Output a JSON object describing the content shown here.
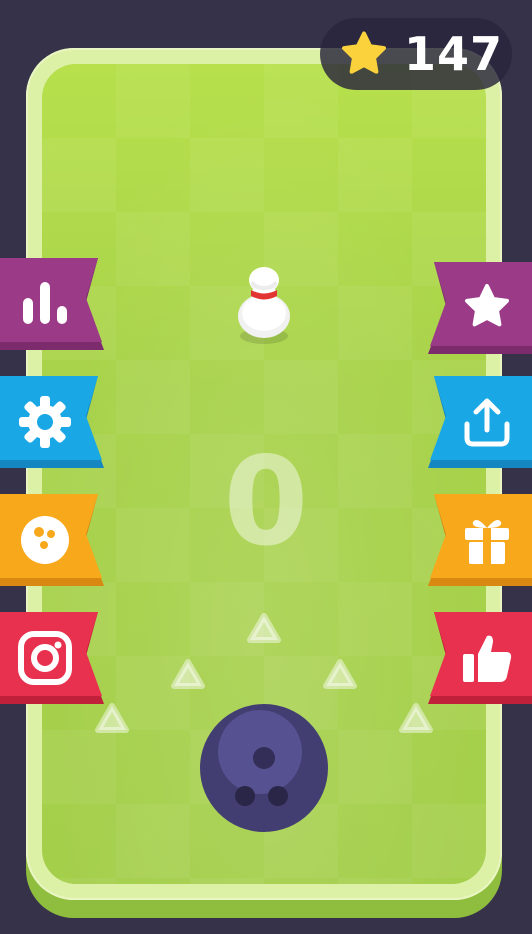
{
  "hud": {
    "score": "147",
    "score_icon": "star-icon",
    "throw_count": "0"
  },
  "left_menu": [
    {
      "id": "leaderboard",
      "icon": "bar-chart-icon",
      "color": "#9b3a87"
    },
    {
      "id": "settings",
      "icon": "gear-icon",
      "color": "#1aa7e6"
    },
    {
      "id": "ball-shop",
      "icon": "bowling-ball-icon",
      "color": "#f7a81b"
    },
    {
      "id": "instagram",
      "icon": "instagram-icon",
      "color": "#e8304f"
    }
  ],
  "right_menu": [
    {
      "id": "rate",
      "icon": "star-icon",
      "color": "#9b3a87"
    },
    {
      "id": "share",
      "icon": "share-icon",
      "color": "#1aa7e6"
    },
    {
      "id": "gift",
      "icon": "gift-icon",
      "color": "#f7a81b"
    },
    {
      "id": "like",
      "icon": "thumbs-up-icon",
      "color": "#e8304f"
    }
  ],
  "colors": {
    "background": "#35324a",
    "field": "#a9d348",
    "ball": "#433e72",
    "star": "#fcd23c"
  }
}
